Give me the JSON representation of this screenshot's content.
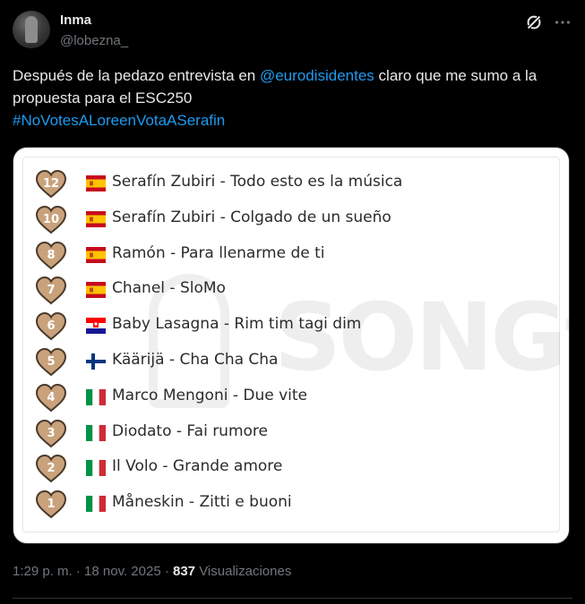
{
  "author": {
    "name": "Inma",
    "handle": "@lobezna_"
  },
  "tweet": {
    "text_a": "Después de la pedazo entrevista en ",
    "mention": "@eurodisidentes",
    "text_b": " claro que me sumo a la propuesta para el ESC250",
    "hashtag": "#NoVotesALoreenVotaASerafin"
  },
  "image": {
    "watermark": "SONGfest",
    "rows": [
      {
        "points": "12",
        "flag": "spain",
        "song": "Serafín Zubiri - Todo esto es la música"
      },
      {
        "points": "10",
        "flag": "spain",
        "song": "Serafín Zubiri - Colgado de un sueño"
      },
      {
        "points": "8",
        "flag": "spain",
        "song": "Ramón - Para llenarme de ti"
      },
      {
        "points": "7",
        "flag": "spain",
        "song": "Chanel - SloMo"
      },
      {
        "points": "6",
        "flag": "croatia",
        "song": "Baby Lasagna - Rim tim tagi dim"
      },
      {
        "points": "5",
        "flag": "finland",
        "song": "Käärijä - Cha Cha Cha"
      },
      {
        "points": "4",
        "flag": "italy",
        "song": "Marco Mengoni - Due vite"
      },
      {
        "points": "3",
        "flag": "italy",
        "song": "Diodato - Fai rumore"
      },
      {
        "points": "2",
        "flag": "italy",
        "song": "Il Volo - Grande amore"
      },
      {
        "points": "1",
        "flag": "italy",
        "song": "Måneskin - Zitti e buoni"
      }
    ]
  },
  "meta": {
    "time": "1:29 p. m. · 18 nov. 2025 · ",
    "views_count": "837",
    "views_label": " Visualizaciones"
  },
  "colors": {
    "background": "#000000",
    "link": "#1d9bf0",
    "heart": "#c9a27c",
    "muted": "#71767b"
  }
}
